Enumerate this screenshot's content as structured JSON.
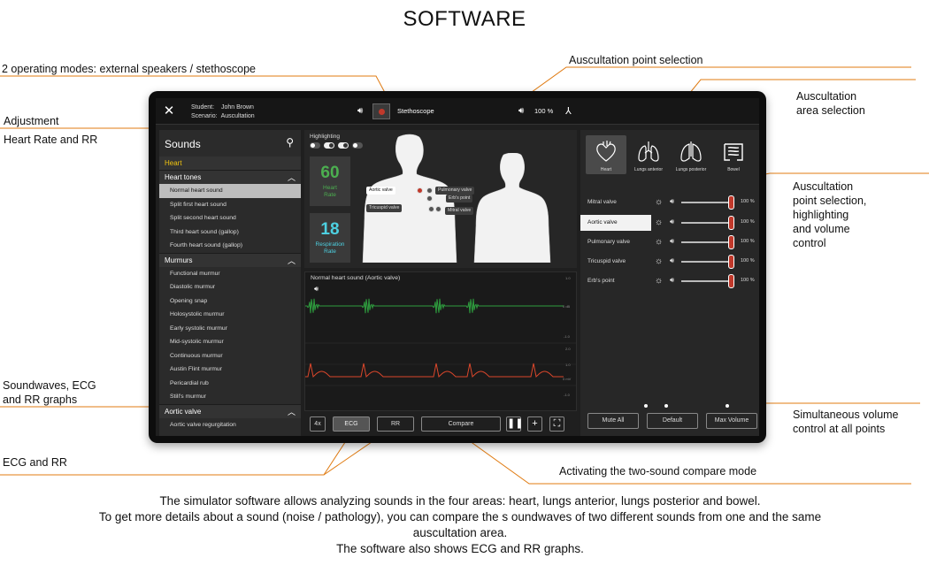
{
  "page_title": "SOFTWARE",
  "callouts": {
    "operating_modes": "2 operating modes: external speakers / stethoscope",
    "auscultation_point_selection": "Auscultation point selection",
    "area_selection_line1": "Auscultation",
    "area_selection_line2": "area selection",
    "adjustment_line1": "Adjustment",
    "adjustment_line2": "Heart Rate and RR",
    "point_sel_line1": "Auscultation",
    "point_sel_line2": "point selection,",
    "point_sel_line3": "highlighting",
    "point_sel_line4": "and volume",
    "point_sel_line5": "control",
    "graphs_line1": "Soundwaves, ECG",
    "graphs_line2": "and RR graphs",
    "volume_line1": "Simultaneous volume",
    "volume_line2": "control at all points",
    "ecg_rr": "ECG and RR",
    "compare_mode": "Activating the two-sound compare mode"
  },
  "caption": {
    "line1": "The simulator software allows analyzing sounds in the four areas: heart, lungs anterior, lungs posterior and bowel.",
    "line2": "To get more details about a sound (noise / pathology), you can compare the s oundwaves of two different sounds from one and the same",
    "line3": "auscultation area.",
    "line4": "The software also shows ECG and RR graphs."
  },
  "app": {
    "topbar": {
      "student_key": "Student:",
      "student_value": "John Brown",
      "scenario_key": "Scenario:",
      "scenario_value": "Auscultation",
      "mode_label": "Stethoscope",
      "volume": "100 %"
    },
    "sidebar": {
      "title": "Sounds",
      "active_category": "Heart",
      "groups": [
        {
          "label": "Heart tones",
          "items": [
            "Normal heart sound",
            "Split first heart sound",
            "Split second heart sound",
            "Third heart sound (gallop)",
            "Fourth heart sound (gallop)"
          ]
        },
        {
          "label": "Murmurs",
          "items": [
            "Functional murmur",
            "Diastolic murmur",
            "Opening snap",
            "Holosystolic murmur",
            "Early systolic murmur",
            "Mid-systolic murmur",
            "Continuous murmur",
            "Austin Flint murmur",
            "Pericardial rub",
            "Still's murmur"
          ]
        },
        {
          "label": "Aortic valve",
          "items": [
            "Aortic valve regurgitation"
          ]
        }
      ]
    },
    "highlighting_label": "Highlighting",
    "heart_rate": {
      "value": "60",
      "label_line1": "Heart",
      "label_line2": "Rate",
      "color": "#4caf50"
    },
    "resp_rate": {
      "value": "18",
      "label_line1": "Respiration",
      "label_line2": "Rate",
      "color": "#4dd0e1"
    },
    "valve_labels": {
      "aortic": "Aortic valve",
      "pulmonary": "Pulmonary valve",
      "erbs": "Erb's point",
      "tricuspid": "Tricuspid valve",
      "mitral": "Mitral valve"
    },
    "graph": {
      "title": "Normal heart sound (Aortic valve)",
      "axis_a_top": "1.0",
      "axis_a_mid": "0 dB",
      "axis_a_bot": "-1.0",
      "axis_b_top": "2.0",
      "axis_b_mid": "1.0",
      "axis_b_mid2": "0 mV",
      "axis_b_bot": "-1.0",
      "soundwave_color": "#2e9e3e",
      "ecg_color": "#d9462b"
    },
    "controls": {
      "speed": "4x",
      "ecg": "ECG",
      "rr": "RR",
      "compare": "Compare",
      "pause_icon": "pause-icon",
      "add_icon": "plus-icon",
      "fullscreen_icon": "fullscreen-icon"
    },
    "areas": [
      {
        "label": "Heart",
        "icon": "heart-icon",
        "selected": true
      },
      {
        "label": "Lungs anterior",
        "icon": "lungs-icon",
        "selected": false
      },
      {
        "label": "Lungs posterior",
        "icon": "lungs-icon",
        "selected": false
      },
      {
        "label": "Bowel",
        "icon": "bowel-icon",
        "selected": false
      }
    ],
    "points": [
      {
        "name": "Mitral valve",
        "volume": "100 %",
        "selected": false
      },
      {
        "name": "Aortic valve",
        "volume": "100 %",
        "selected": true
      },
      {
        "name": "Pulmonary valve",
        "volume": "100 %",
        "selected": false
      },
      {
        "name": "Tricuspid valve",
        "volume": "100 %",
        "selected": false
      },
      {
        "name": "Erb's point",
        "volume": "100 %",
        "selected": false
      }
    ],
    "bottom_buttons": {
      "mute_all": "Mute All",
      "default": "Default",
      "max_volume": "Max Volume"
    },
    "accent_color": "#c0392b"
  }
}
